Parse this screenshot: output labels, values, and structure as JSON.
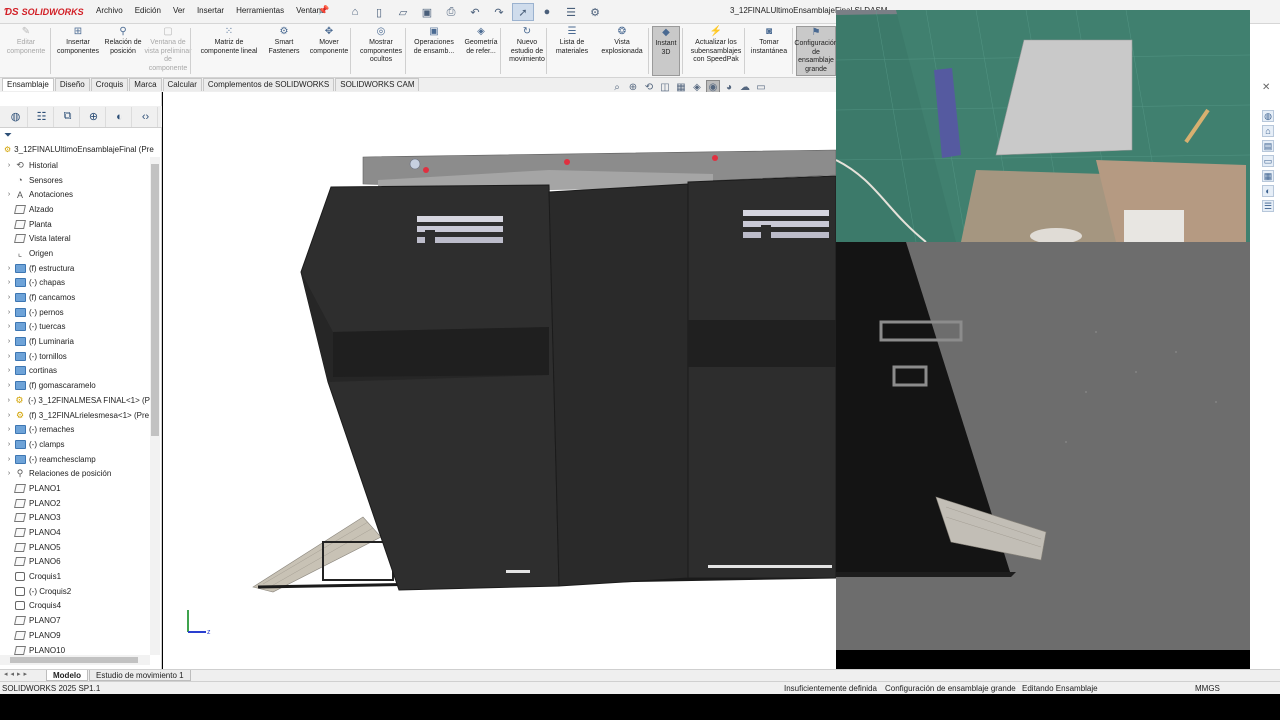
{
  "app": {
    "name": "SOLIDWORKS",
    "document_title": "3_12FINALUltimoEnsamblajeFinal.SLDASM"
  },
  "menu": [
    "Archivo",
    "Edición",
    "Ver",
    "Insertar",
    "Herramientas",
    "Ventana"
  ],
  "command_manager": [
    {
      "label": "Editar componente",
      "icon": "edit-component-icon",
      "disabled": true
    },
    {
      "label": "Insertar componentes",
      "icon": "insert-components-icon"
    },
    {
      "label": "Relación de posición",
      "icon": "mate-icon"
    },
    {
      "label": "Ventana de vista preliminar de componente",
      "icon": "preview-window-icon",
      "disabled": true
    },
    {
      "label": "Matriz de componente lineal",
      "icon": "linear-pattern-icon"
    },
    {
      "label": "Smart Fasteners",
      "icon": "smart-fasteners-icon"
    },
    {
      "label": "Mover componente",
      "icon": "move-component-icon"
    },
    {
      "label": "Mostrar componentes ocultos",
      "icon": "show-hidden-icon"
    },
    {
      "label": "Operaciones de ensamb...",
      "icon": "assembly-features-icon"
    },
    {
      "label": "Geometría de refer...",
      "icon": "reference-geometry-icon"
    },
    {
      "label": "Nuevo estudio de movimiento",
      "icon": "motion-study-icon"
    },
    {
      "label": "Lista de materiales",
      "icon": "bom-icon"
    },
    {
      "label": "Vista explosionada",
      "icon": "exploded-view-icon"
    },
    {
      "label": "Instant 3D",
      "icon": "instant3d-icon",
      "toggled": true
    },
    {
      "label": "Actualizar los subensamblajes con SpeedPak",
      "icon": "speedpak-icon"
    },
    {
      "label": "Tomar instantánea",
      "icon": "snapshot-icon"
    },
    {
      "label": "Configuración de ensamblaje grande",
      "icon": "large-assembly-icon",
      "toggled": true
    }
  ],
  "tabs": [
    "Ensamblaje",
    "Diseño",
    "Croquis",
    "Marca",
    "Calcular",
    "Complementos de SOLIDWORKS",
    "SOLIDWORKS CAM"
  ],
  "feature_manager": {
    "root": "3_12FINALUltimoEnsamblajeFinal (Pre",
    "items": [
      {
        "label": "Historial",
        "icon": "history",
        "arrow": true
      },
      {
        "label": "Sensores",
        "icon": "sensor",
        "arrow": false
      },
      {
        "label": "Anotaciones",
        "icon": "annotation",
        "arrow": true
      },
      {
        "label": "Alzado",
        "icon": "plane",
        "arrow": false
      },
      {
        "label": "Planta",
        "icon": "plane",
        "arrow": false
      },
      {
        "label": "Vista lateral",
        "icon": "plane",
        "arrow": false
      },
      {
        "label": "Origen",
        "icon": "origin",
        "arrow": false
      },
      {
        "label": "(f) estructura",
        "icon": "folder",
        "arrow": true
      },
      {
        "label": "(-) chapas",
        "icon": "folder",
        "arrow": true
      },
      {
        "label": "(f) cancamos",
        "icon": "folder",
        "arrow": true
      },
      {
        "label": "(-) pernos",
        "icon": "folder",
        "arrow": true
      },
      {
        "label": "(-) tuercas",
        "icon": "folder",
        "arrow": true
      },
      {
        "label": "(f) Luminaria",
        "icon": "folder",
        "arrow": true
      },
      {
        "label": "(-) tornillos",
        "icon": "folder",
        "arrow": true
      },
      {
        "label": "cortinas",
        "icon": "folder",
        "arrow": true
      },
      {
        "label": "(f) gomascaramelo",
        "icon": "folder",
        "arrow": true
      },
      {
        "label": "(-) 3_12FINALMESA FINAL<1> (P",
        "icon": "component",
        "arrow": true
      },
      {
        "label": "(f) 3_12FINALrielesmesa<1> (Pre",
        "icon": "component",
        "arrow": true
      },
      {
        "label": "(-) remaches",
        "icon": "folder",
        "arrow": true
      },
      {
        "label": "(-) clamps",
        "icon": "folder",
        "arrow": true
      },
      {
        "label": "(-) reamchesclamp",
        "icon": "folder",
        "arrow": true
      },
      {
        "label": "Relaciones de posición",
        "icon": "mates",
        "arrow": true
      },
      {
        "label": "PLANO1",
        "icon": "plane",
        "arrow": false
      },
      {
        "label": "PLANO2",
        "icon": "plane",
        "arrow": false
      },
      {
        "label": "PLANO3",
        "icon": "plane",
        "arrow": false
      },
      {
        "label": "PLANO4",
        "icon": "plane",
        "arrow": false
      },
      {
        "label": "PLANO5",
        "icon": "plane",
        "arrow": false
      },
      {
        "label": "PLANO6",
        "icon": "plane",
        "arrow": false
      },
      {
        "label": "Croquis1",
        "icon": "sketch",
        "arrow": false
      },
      {
        "label": "(-) Croquis2",
        "icon": "sketch",
        "arrow": false
      },
      {
        "label": "Croquis4",
        "icon": "sketch",
        "arrow": false
      },
      {
        "label": "PLANO7",
        "icon": "plane",
        "arrow": false
      },
      {
        "label": "PLANO9",
        "icon": "plane",
        "arrow": false
      },
      {
        "label": "PLANO10",
        "icon": "plane",
        "arrow": false
      }
    ]
  },
  "bottom_tabs": [
    "Modelo",
    "Estudio de movimiento 1"
  ],
  "status_bar": {
    "version": "SOLIDWORKS 2025 SP1.1",
    "definition": "Insuficientemente definida",
    "config": "Configuración de ensamblaje grande",
    "mode": "Editando Ensamblaje",
    "units": "MMGS"
  },
  "colors": {
    "brand": "#d21f26",
    "model_dark": "#2b2b2b",
    "webcam_mat": "#2e6b5e"
  }
}
